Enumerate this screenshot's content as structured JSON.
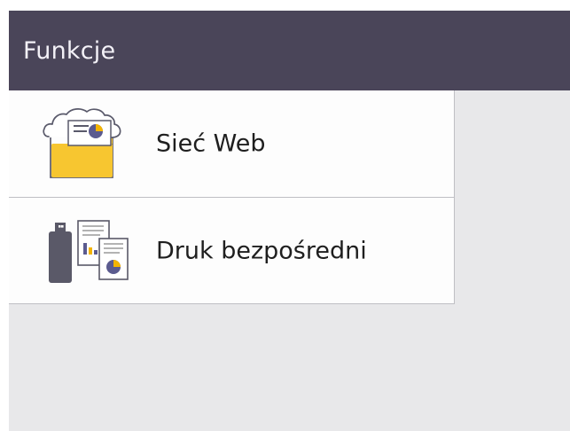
{
  "header": {
    "title": "Funkcje"
  },
  "menu": {
    "items": [
      {
        "label": "Sieć Web",
        "icon": "web-folder-icon"
      },
      {
        "label": "Druk bezpośredni",
        "icon": "usb-direct-print-icon"
      }
    ]
  },
  "colors": {
    "header_bg": "#4a4559",
    "header_text": "#f3f1f7",
    "list_bg": "#fdfdfd",
    "panel_bg": "#e8e8ea",
    "divider": "#bfbfc4",
    "folder": "#f7c630",
    "pie_main": "#5b5b8f",
    "pie_accent": "#f4b400"
  }
}
